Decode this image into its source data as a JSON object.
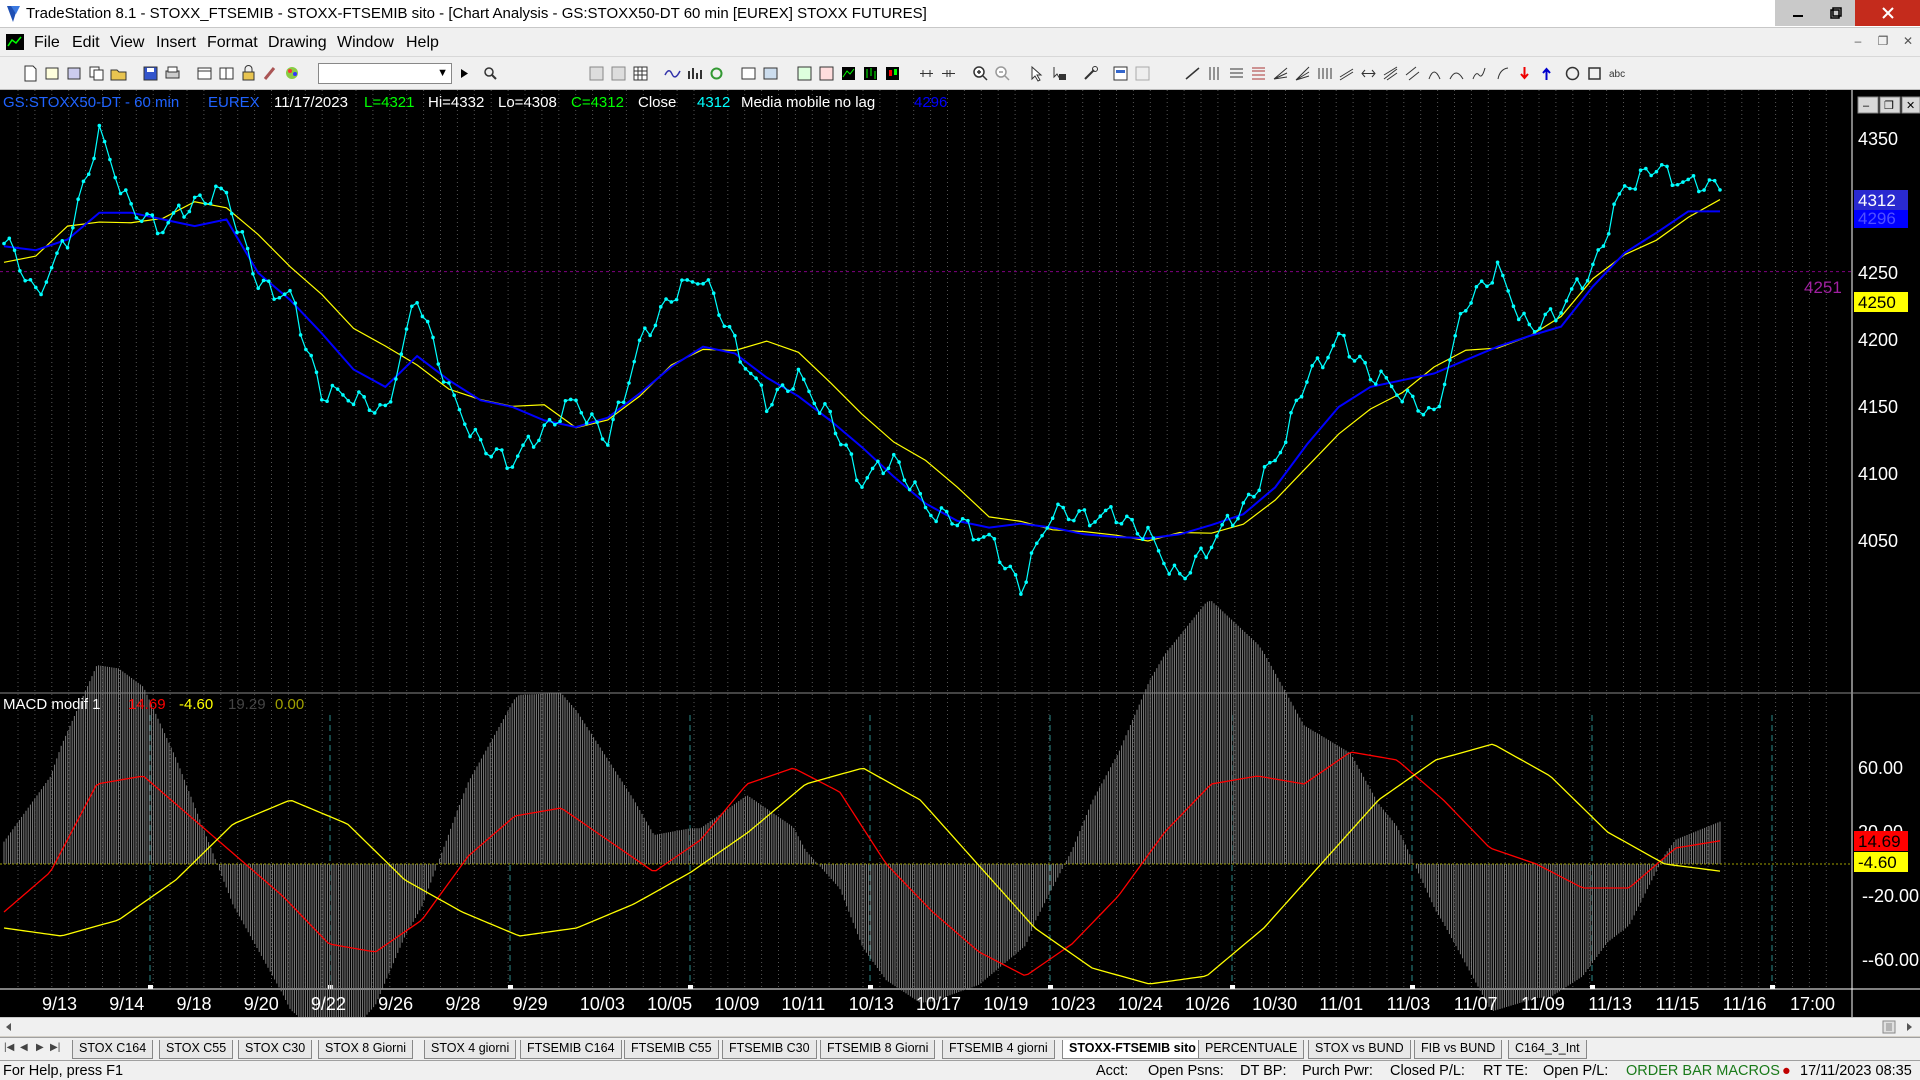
{
  "window": {
    "title": "TradeStation 8.1 - STOXX_FTSEMIB - STOXX-FTSEMIB sito - [Chart Analysis - GS:STOXX50-DT  60 min  [EUREX] STOXX FUTURES]"
  },
  "menu": {
    "items": [
      "File",
      "Edit",
      "View",
      "Insert",
      "Format",
      "Drawing",
      "Window",
      "Help"
    ]
  },
  "toolbar": {
    "symbol_value": ""
  },
  "chart": {
    "header": {
      "symbol": "GS:STOXX50-DT - 60 min",
      "exchange": "EUREX",
      "date": "11/17/2023",
      "low_last": "L=4321",
      "high": "Hi=4332",
      "low": "Lo=4308",
      "close": "C=4312",
      "close_label": "Close",
      "close_value": "4312",
      "ma_label": "Media mobile no lag",
      "ma_value": "4296"
    },
    "price_axis": [
      "4350",
      "4300",
      "4250",
      "4200",
      "4150",
      "4100",
      "4050"
    ],
    "price_markers": {
      "close": "4312",
      "ma": "4296",
      "level": "4250",
      "level_label": "4251"
    },
    "indicator_header": {
      "name": "MACD modif 1",
      "v1": "14.69",
      "v2": "-4.60",
      "v3": "19.29",
      "v4": "0.00"
    },
    "indicator_axis": [
      "60.00",
      "20.00",
      "-20.00",
      "-60.00"
    ],
    "indicator_markers": {
      "macd": "14.69",
      "signal": "-4.60"
    },
    "dates": [
      "9/13",
      "9/14",
      "9/18",
      "9/20",
      "9/22",
      "9/26",
      "9/28",
      "9/29",
      "10/03",
      "10/05",
      "10/09",
      "10/11",
      "10/13",
      "10/17",
      "10/19",
      "10/23",
      "10/24",
      "10/26",
      "10/30",
      "11/01",
      "11/03",
      "11/07",
      "11/09",
      "11/13",
      "11/15",
      "11/16",
      "17:00"
    ],
    "colors": {
      "price": "#00ffff",
      "ma_blue": "#0000ff",
      "ma_yellow": "#ffff00",
      "macd": "#ff0000",
      "signal": "#ffff00",
      "hist": "#7f7f7f",
      "level": "#800080"
    }
  },
  "chart_data": {
    "type": "line",
    "title": "GS:STOXX50-DT - 60 min",
    "series": [
      {
        "name": "Close",
        "values": [
          4280,
          4236,
          4272,
          4352,
          4300,
          4285,
          4300,
          4310,
          4245,
          4232,
          4157,
          4160,
          4148,
          4231,
          4160,
          4124,
          4110,
          4130,
          4155,
          4128,
          4195,
          4230,
          4250,
          4200,
          4150,
          4170,
          4145,
          4095,
          4108,
          4075,
          4068,
          4050,
          4012,
          4075,
          4070,
          4067,
          4052,
          4024,
          4050,
          4072,
          4110,
          4175,
          4200,
          4172,
          4162,
          4145,
          4225,
          4250,
          4210,
          4225,
          4250,
          4315,
          4332,
          4315,
          4312
        ]
      },
      {
        "name": "Media mobile no lag",
        "values": [
          4270,
          4267,
          4275,
          4295,
          4295,
          4290,
          4285,
          4290,
          4250,
          4230,
          4205,
          4178,
          4165,
          4188,
          4170,
          4155,
          4150,
          4140,
          4135,
          4142,
          4160,
          4180,
          4195,
          4190,
          4172,
          4158,
          4140,
          4120,
          4098,
          4078,
          4065,
          4060,
          4063,
          4060,
          4055,
          4053,
          4052,
          4055,
          4062,
          4070,
          4090,
          4122,
          4150,
          4165,
          4170,
          4175,
          4185,
          4195,
          4203,
          4210,
          4240,
          4265,
          4280,
          4296,
          4296
        ]
      }
    ],
    "macd": {
      "name": "MACD modif 1",
      "values": [
        -30,
        -5,
        50,
        55,
        30,
        5,
        -20,
        -50,
        -55,
        -35,
        5,
        30,
        35,
        15,
        -5,
        15,
        50,
        60,
        45,
        0,
        -30,
        -55,
        -70,
        -50,
        -20,
        20,
        50,
        55,
        50,
        70,
        65,
        40,
        10,
        0,
        -15,
        -15,
        10,
        14.69
      ],
      "signal": [
        -40,
        -45,
        -35,
        -10,
        25,
        40,
        25,
        -10,
        -30,
        -45,
        -40,
        -25,
        -5,
        20,
        50,
        60,
        40,
        0,
        -40,
        -65,
        -75,
        -70,
        -40,
        0,
        40,
        65,
        75,
        55,
        20,
        0,
        -4.6
      ],
      "ylim": [
        -70,
        80
      ]
    },
    "price_ylim": [
      4000,
      4370
    ]
  }
}
